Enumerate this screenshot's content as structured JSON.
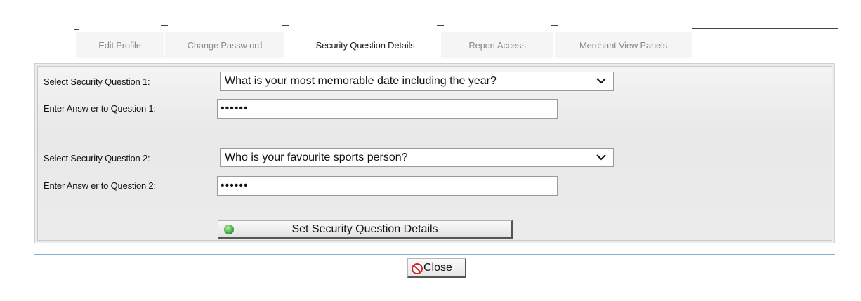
{
  "tabs": [
    {
      "label": "Edit Profile",
      "active": false
    },
    {
      "label": "Change Passw ord",
      "active": false
    },
    {
      "label": "Security Question Details",
      "active": true
    },
    {
      "label": "Report Access",
      "active": false
    },
    {
      "label": "Merchant View Panels",
      "active": false
    }
  ],
  "form": {
    "q1_label": "Select Security Question 1:",
    "q1_value": "What is your most memorable date including the year?",
    "a1_label": "Enter Answ er to Question 1:",
    "a1_value": "••••••",
    "q2_label": "Select Security Question 2:",
    "q2_value": "Who is your favourite sports person?",
    "a2_label": "Enter Answ er to Question 2:",
    "a2_value": "••••••",
    "submit_label": "Set Security Question Details"
  },
  "footer": {
    "close_label": "Close"
  },
  "colors": {
    "divider": "#7fb0d8",
    "ok_icon": "#2e9b2e",
    "close_icon": "#d12a2a"
  },
  "icons": {
    "submit": "check-circle-icon",
    "close": "no-entry-icon",
    "dropdown": "chevron-down-icon"
  }
}
